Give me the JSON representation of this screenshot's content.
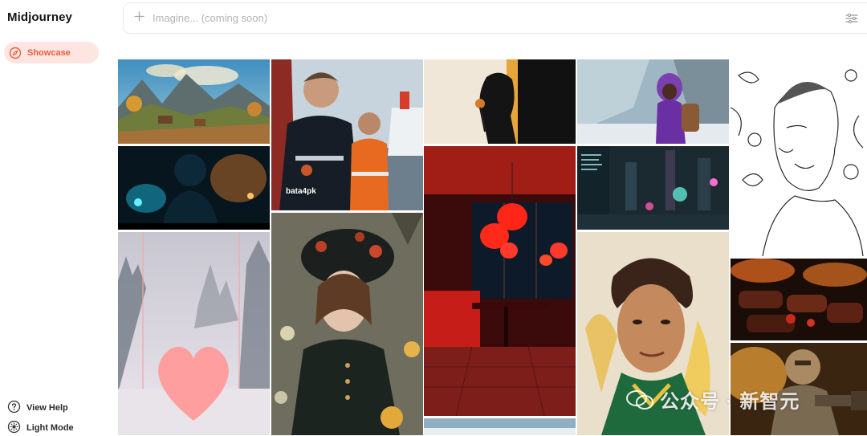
{
  "app": {
    "brand": "Midjourney"
  },
  "sidebar": {
    "nav": [
      {
        "label": "Showcase",
        "icon": "compass-icon",
        "active": true
      }
    ],
    "footer": [
      {
        "label": "View Help",
        "icon": "help-circle-icon"
      },
      {
        "label": "Light Mode",
        "icon": "sun-icon"
      }
    ]
  },
  "search": {
    "placeholder": "Imagine... (coming soon)",
    "icon": "plus-icon",
    "right_icon": "sliders-icon"
  },
  "colors": {
    "accent": "#ef5a3c",
    "accent_bg": "#fde6e1"
  },
  "gallery": {
    "images": [
      {
        "id": "mountain-village"
      },
      {
        "id": "firefighters-ship",
        "caption": "bata4pk"
      },
      {
        "id": "woman-rose-silhouette"
      },
      {
        "id": "girl-purple-hood"
      },
      {
        "id": "line-art-portrait"
      },
      {
        "id": "man-neon-street"
      },
      {
        "id": "red-diner-lanterns"
      },
      {
        "id": "futuristic-city"
      },
      {
        "id": "pink-heart-forest"
      },
      {
        "id": "girl-floral-hat"
      },
      {
        "id": "painted-man-portrait"
      },
      {
        "id": "grilled-meat"
      },
      {
        "id": "armored-warrior"
      }
    ]
  },
  "watermark": {
    "text": "公众号 · 新智元"
  }
}
